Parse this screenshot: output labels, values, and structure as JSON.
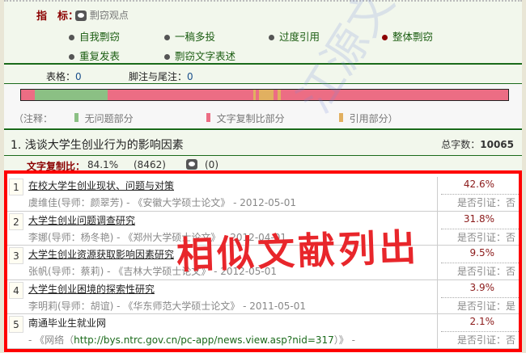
{
  "indicator": {
    "label": "指　标：",
    "view": "剽窃观点"
  },
  "indicators": [
    {
      "label": "自我剽窃",
      "color": "#555555"
    },
    {
      "label": "一稿多投",
      "color": "#555555"
    },
    {
      "label": "过度引用",
      "color": "#555555"
    },
    {
      "label": "整体剽窃",
      "color": "#8b0000"
    },
    {
      "label": "重复发表",
      "color": "#555555"
    },
    {
      "label": "剽窃文字表述",
      "color": "#555555"
    }
  ],
  "counts": {
    "table_label": "表格：",
    "table": "0",
    "footnote_label": "脚注与尾注：",
    "footnote": "0"
  },
  "bar_segments": [
    {
      "type": "copy",
      "fraction": 0.028
    },
    {
      "type": "ok",
      "fraction": 0.15
    },
    {
      "type": "copy",
      "fraction": 0.299
    },
    {
      "type": "cite",
      "fraction": 0.005
    },
    {
      "type": "copy",
      "fraction": 0.006
    },
    {
      "type": "cite",
      "fraction": 0.03
    },
    {
      "type": "copy",
      "fraction": 0.008
    },
    {
      "type": "cite",
      "fraction": 0.007
    },
    {
      "type": "copy",
      "fraction": 0.467
    }
  ],
  "colors": {
    "ok": "#8bc084",
    "copy": "#ec6d84",
    "cite": "#e1b060"
  },
  "legend": {
    "prefix": "（注释：",
    "ok": "无问题部分",
    "copy": "文字复制比部分",
    "cite": "引用部分）"
  },
  "section": {
    "title": "1. 浅谈大学生创业行为的影响因素",
    "total_label": "总字数：",
    "total": "10065"
  },
  "copy_ratio": {
    "label": "文字复制比：",
    "value": "84.1%",
    "chars": "(8462)",
    "comments": "(0)"
  },
  "results": [
    {
      "num": "1",
      "title": "在校大学生创业现状、问题与对策",
      "author": "虞维佳(导师：颜翠芳) - 《安徽大学硕士论文》 - 2012-05-01",
      "pct": "42.6%",
      "cite": "是否引证：否"
    },
    {
      "num": "2",
      "title": "大学生创业问题调查研究",
      "author": "李娜(导师：杨冬艳) - 《郑州大学硕士论文》 - 2012-04-01",
      "pct": "31.8%",
      "cite": "是否引证：否"
    },
    {
      "num": "3",
      "title": "大学生创业资源获取影响因素研究",
      "author": "张帆(导师：蔡莉) - 《吉林大学硕士论文》 - 2012-05-01",
      "pct": "9.5%",
      "cite": "是否引证：否"
    },
    {
      "num": "4",
      "title": "大学生创业困境的探索性研究",
      "author": "李明莉(导师：胡谊) - 《华东师范大学硕士论文》 - 2011-05-01",
      "pct": "3.9%",
      "cite": "是否引证：是"
    },
    {
      "num": "5",
      "title": "南通毕业生就业网",
      "author_pre": " - 《网络（",
      "link": "http://bys.ntrc.gov.cn/pc-app/news.view.asp?nid=317",
      "author_post": "）》 -",
      "pct": "2.1%",
      "cite": "是否引证：否"
    }
  ],
  "annotation": "相似文献列出",
  "watermark": "江源文化传播"
}
